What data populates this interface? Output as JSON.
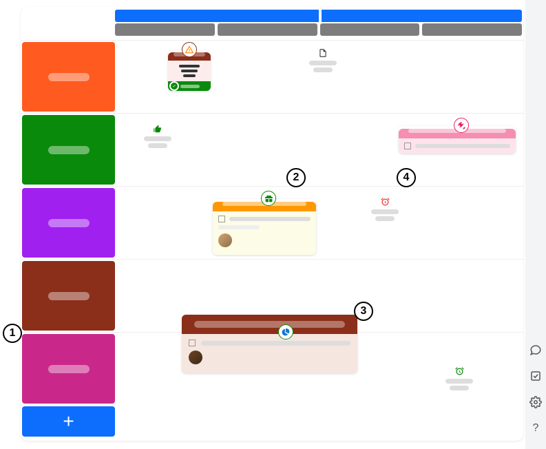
{
  "numberedMarkers": {
    "m1": "1",
    "m2": "2",
    "m3": "3",
    "m4": "4"
  },
  "rows": [
    {
      "color": "#ff5a1f"
    },
    {
      "color": "#0a8a0a"
    },
    {
      "color": "#a020f0"
    },
    {
      "color": "#8b2e1a"
    },
    {
      "color": "#c9288a"
    }
  ],
  "headerColumns": 4,
  "addButton": {
    "symbol": "+"
  },
  "miniItems": {
    "file": {
      "icon": "file"
    },
    "thumbs": {
      "icon": "thumbs-up"
    },
    "alarmRed": {
      "icon": "alarm-red"
    },
    "alarmGreen": {
      "icon": "alarm-green"
    }
  },
  "cardBadges": {
    "warning": "warning",
    "gift": "gift",
    "rocket": "rocket",
    "piechart": "piechart"
  },
  "sidebarIcons": [
    "chat",
    "checkbox",
    "settings",
    "help"
  ],
  "helpSymbol": "?"
}
